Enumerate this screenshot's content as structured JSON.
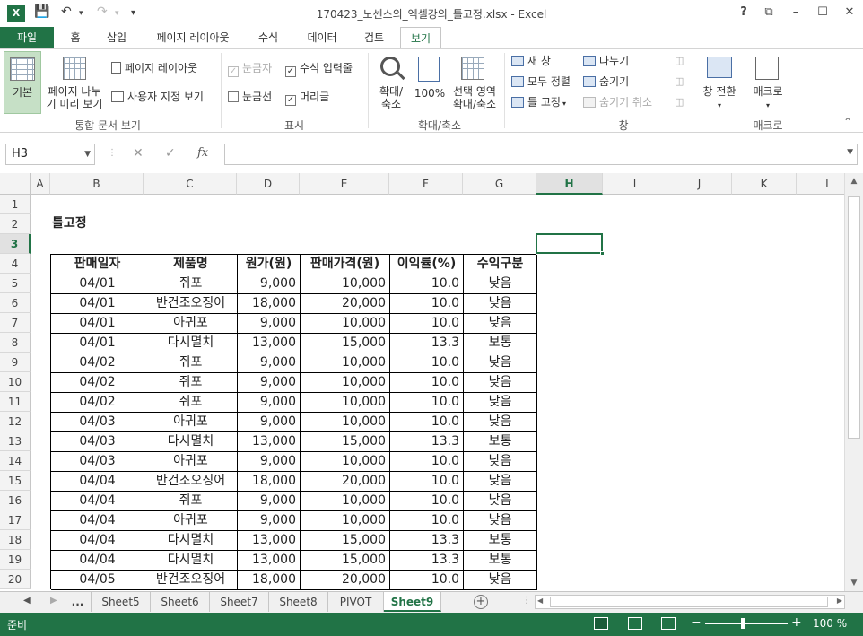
{
  "app": {
    "title": "170423_노센스의_엑셀강의_틀고정.xlsx - Excel",
    "logo": "X"
  },
  "window_controls": [
    "?",
    "⧉",
    "–",
    "☐",
    "✕"
  ],
  "menu": {
    "file": "파일",
    "tabs": [
      "홈",
      "삽입",
      "페이지 레이아웃",
      "수식",
      "데이터",
      "검토",
      "보기"
    ],
    "active": "보기"
  },
  "ribbon": {
    "workbook_views": {
      "normal": "기본",
      "page_break": "페이지 나누\n기 미리 보기",
      "page_layout": "페이지 레이아웃",
      "custom_views": "사용자 지정 보기",
      "group_label": "통합 문서 보기"
    },
    "show": {
      "ruler": "눈금자",
      "formula_bar": "수식 입력줄",
      "gridlines": "눈금선",
      "headings": "머리글",
      "group_label": "표시"
    },
    "zoom": {
      "zoom": "확대/\n축소",
      "hundred": "100%",
      "zoom_selection": "선택 영역\n확대/축소",
      "group_label": "확대/축소"
    },
    "window": {
      "new_window": "새 창",
      "arrange_all": "모두 정렬",
      "freeze_panes": "틀 고정",
      "split": "나누기",
      "hide": "숨기기",
      "unhide": "숨기기 취소",
      "switch_windows": "창 전환",
      "group_label": "창"
    },
    "macros": {
      "macros": "매크로",
      "group_label": "매크로"
    }
  },
  "formula_bar": {
    "name_box": "H3",
    "fx": "fx",
    "value": ""
  },
  "columns": [
    "A",
    "B",
    "C",
    "D",
    "E",
    "F",
    "G",
    "H",
    "I",
    "J",
    "K",
    "L"
  ],
  "selected_column": "H",
  "rows": [
    "1",
    "2",
    "3",
    "4",
    "5",
    "6",
    "7",
    "8",
    "9",
    "10",
    "11",
    "12",
    "13",
    "14",
    "15",
    "16",
    "17",
    "18",
    "19",
    "20"
  ],
  "selected_row": "3",
  "sheet_title": "틀고정",
  "table": {
    "headers": [
      "판매일자",
      "제품명",
      "원가(원)",
      "판매가격(원)",
      "이익률(%)",
      "수익구분"
    ],
    "rows": [
      [
        "04/01",
        "쥐포",
        "9,000",
        "10,000",
        "10.0",
        "낮음"
      ],
      [
        "04/01",
        "반건조오징어",
        "18,000",
        "20,000",
        "10.0",
        "낮음"
      ],
      [
        "04/01",
        "아귀포",
        "9,000",
        "10,000",
        "10.0",
        "낮음"
      ],
      [
        "04/01",
        "다시멸치",
        "13,000",
        "15,000",
        "13.3",
        "보통"
      ],
      [
        "04/02",
        "쥐포",
        "9,000",
        "10,000",
        "10.0",
        "낮음"
      ],
      [
        "04/02",
        "쥐포",
        "9,000",
        "10,000",
        "10.0",
        "낮음"
      ],
      [
        "04/02",
        "쥐포",
        "9,000",
        "10,000",
        "10.0",
        "낮음"
      ],
      [
        "04/03",
        "아귀포",
        "9,000",
        "10,000",
        "10.0",
        "낮음"
      ],
      [
        "04/03",
        "다시멸치",
        "13,000",
        "15,000",
        "13.3",
        "보통"
      ],
      [
        "04/03",
        "아귀포",
        "9,000",
        "10,000",
        "10.0",
        "낮음"
      ],
      [
        "04/04",
        "반건조오징어",
        "18,000",
        "20,000",
        "10.0",
        "낮음"
      ],
      [
        "04/04",
        "쥐포",
        "9,000",
        "10,000",
        "10.0",
        "낮음"
      ],
      [
        "04/04",
        "아귀포",
        "9,000",
        "10,000",
        "10.0",
        "낮음"
      ],
      [
        "04/04",
        "다시멸치",
        "13,000",
        "15,000",
        "13.3",
        "보통"
      ],
      [
        "04/04",
        "다시멸치",
        "13,000",
        "15,000",
        "13.3",
        "보통"
      ],
      [
        "04/05",
        "반건조오징어",
        "18,000",
        "20,000",
        "10.0",
        "낮음"
      ]
    ]
  },
  "sheet_tabs": {
    "ellipsis": "...",
    "tabs": [
      "Sheet5",
      "Sheet6",
      "Sheet7",
      "Sheet8",
      "PIVOT",
      "Sheet9"
    ],
    "active": "Sheet9",
    "add": "+"
  },
  "status": {
    "ready": "준비",
    "zoom": "100 %"
  },
  "colors": {
    "accent": "#217346"
  }
}
